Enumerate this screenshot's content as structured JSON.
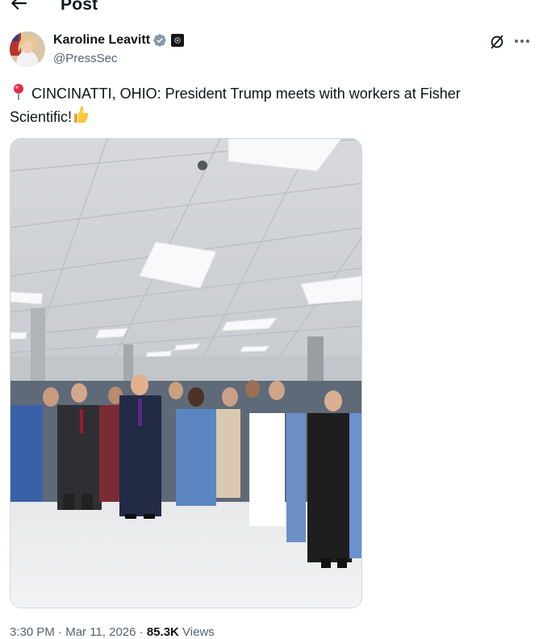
{
  "header": {
    "title": "Post"
  },
  "author": {
    "name": "Karoline Leavitt",
    "handle": "@PressSec"
  },
  "tweet": {
    "text_main": " CINCINATTI, OHIO: President Trump meets with workers at Fisher Scientific!",
    "leading_emoji": "round-pushpin-icon",
    "trailing_emoji": "thumbs-up-icon"
  },
  "meta": {
    "time": "3:30 PM",
    "sep1": " · ",
    "date": "Mar 11, 2026",
    "sep2": " · ",
    "views_count": "85.3K",
    "views_label": " Views"
  },
  "colors": {
    "text": "#0f1419",
    "secondary": "#536471",
    "verified": "#829aab",
    "border": "#cfd9de"
  }
}
